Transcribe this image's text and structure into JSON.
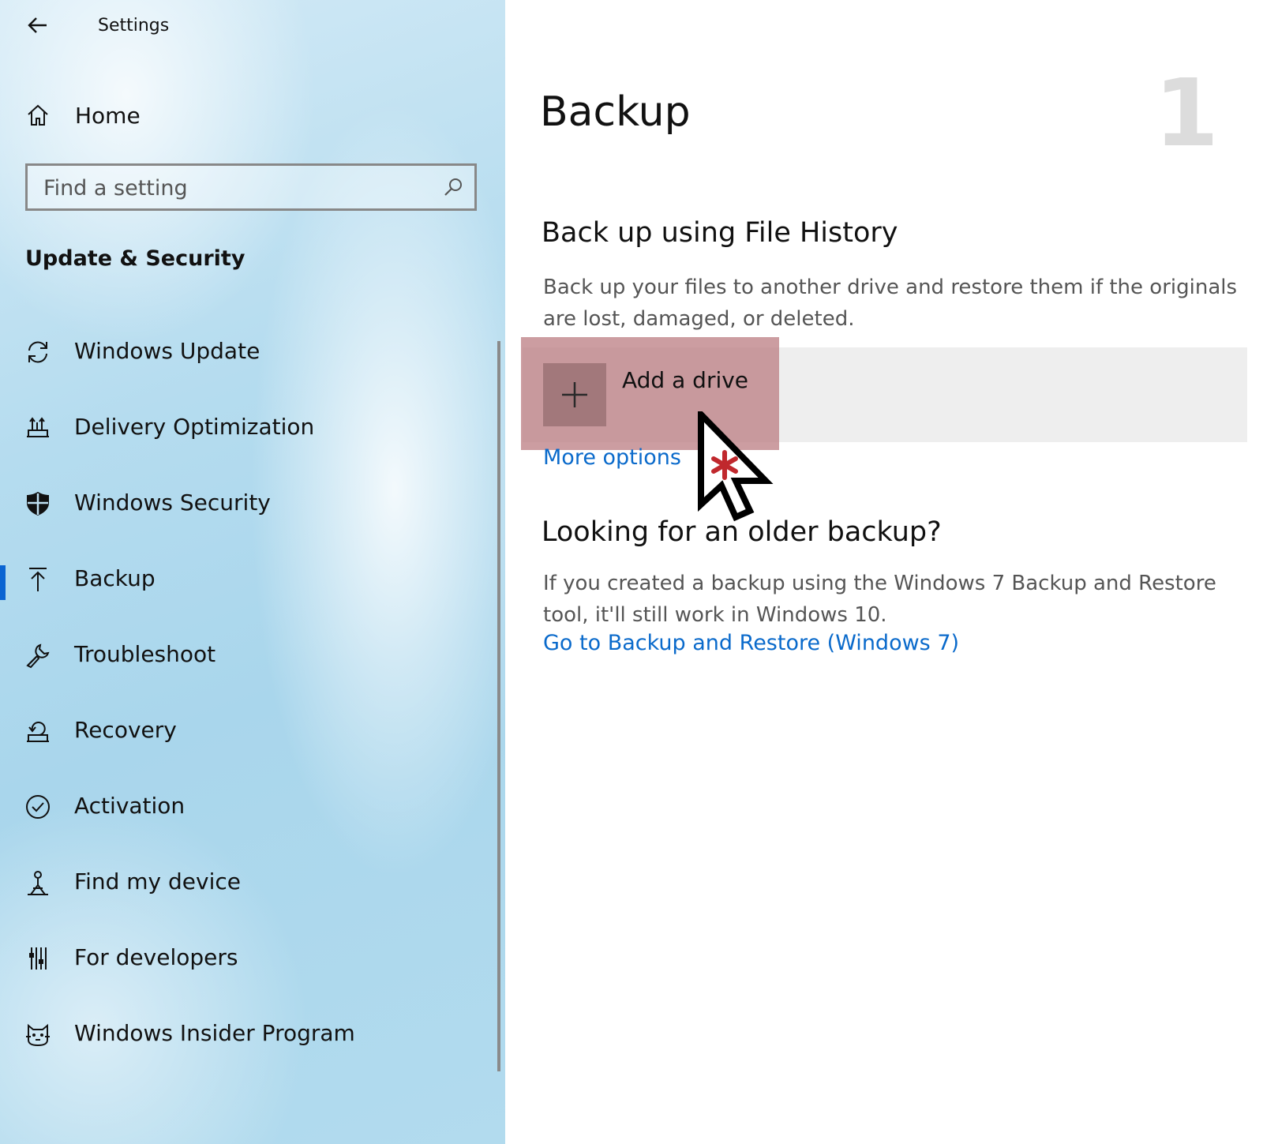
{
  "app": {
    "title": "Settings"
  },
  "sidebar": {
    "home_label": "Home",
    "search_placeholder": "Find a setting",
    "section_title": "Update & Security",
    "items": [
      {
        "label": "Windows Update",
        "icon": "refresh-icon"
      },
      {
        "label": "Delivery Optimization",
        "icon": "delivery-optimization-icon"
      },
      {
        "label": "Windows Security",
        "icon": "shield-icon"
      },
      {
        "label": "Backup",
        "icon": "upload-arrow-icon",
        "active": true
      },
      {
        "label": "Troubleshoot",
        "icon": "wrench-icon"
      },
      {
        "label": "Recovery",
        "icon": "recovery-icon"
      },
      {
        "label": "Activation",
        "icon": "check-circle-icon"
      },
      {
        "label": "Find my device",
        "icon": "find-device-icon"
      },
      {
        "label": "For developers",
        "icon": "developer-tools-icon"
      },
      {
        "label": "Windows Insider Program",
        "icon": "insider-cat-icon"
      }
    ]
  },
  "main": {
    "page_title": "Backup",
    "step_number": "1",
    "file_history": {
      "heading": "Back up using File History",
      "description": "Back up your files to another drive and restore them if the originals are lost, damaged, or deleted.",
      "add_drive_label": "Add a drive",
      "more_options_label": "More options"
    },
    "older_backup": {
      "heading": "Looking for an older backup?",
      "description": "If you created a backup using the Windows 7 Backup and Restore tool, it'll still work in Windows 10.",
      "link_label": "Go to Backup and Restore (Windows 7)"
    }
  },
  "colors": {
    "accent": "#0a64d2",
    "link": "#0a6acb",
    "highlight": "#be8287",
    "cursor_marker": "#c0282d"
  }
}
